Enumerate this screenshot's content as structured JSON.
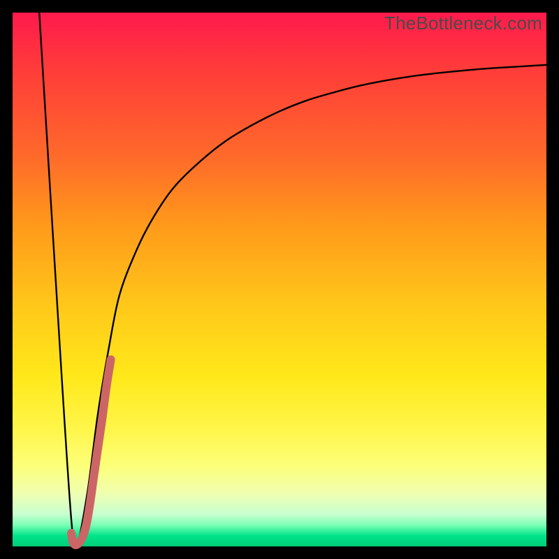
{
  "watermark": "TheBottleneck.com",
  "chart_data": {
    "type": "line",
    "title": "",
    "xlabel": "",
    "ylabel": "",
    "xlim": [
      0,
      100
    ],
    "ylim": [
      0,
      100
    ],
    "series": [
      {
        "name": "main-curve",
        "color": "#000000",
        "x": [
          5,
          9,
          11,
          12,
          14,
          16,
          18,
          20,
          23,
          26,
          30,
          35,
          40,
          45,
          50,
          55,
          60,
          65,
          70,
          75,
          80,
          85,
          90,
          95,
          100
        ],
        "y": [
          100,
          35,
          5,
          0,
          10,
          25,
          37,
          47,
          55,
          61,
          67,
          72,
          76,
          79,
          81.5,
          83.5,
          85,
          86.3,
          87.3,
          88.1,
          88.7,
          89.2,
          89.6,
          89.9,
          90.2
        ]
      },
      {
        "name": "accent-hook",
        "color": "#cc6666",
        "x": [
          11,
          11.3,
          12,
          13,
          13.8,
          14.5,
          15.2,
          16,
          16.8,
          17.6,
          18.4
        ],
        "y": [
          2.5,
          0.8,
          0.3,
          1.5,
          4,
          8,
          13,
          18.5,
          24,
          30,
          35
        ]
      }
    ],
    "annotations": []
  }
}
